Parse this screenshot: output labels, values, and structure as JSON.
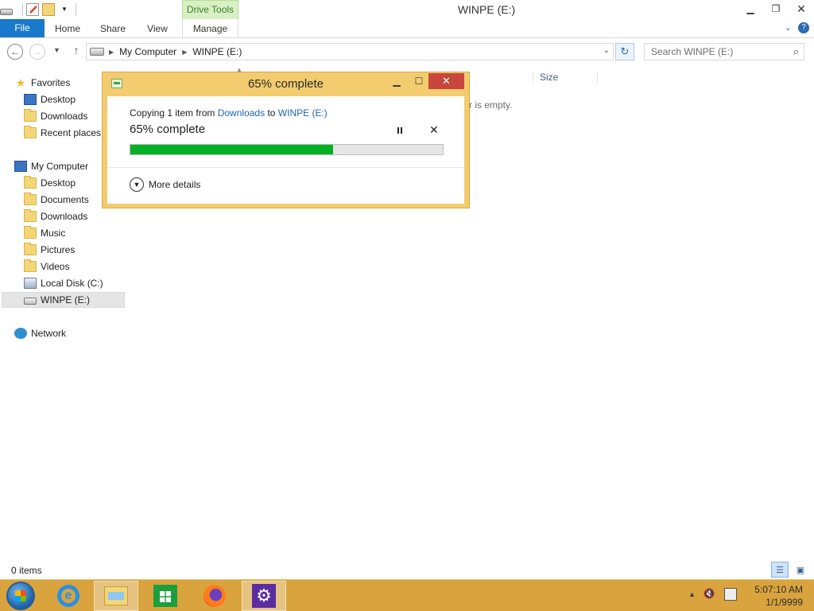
{
  "window": {
    "title": "WINPE (E:)",
    "contextual_tab": "Drive Tools"
  },
  "ribbon": {
    "tabs": [
      "File",
      "Home",
      "Share",
      "View",
      "Manage"
    ]
  },
  "address": {
    "crumbs": [
      "My Computer",
      "WINPE (E:)"
    ],
    "search_placeholder": "Search WINPE (E:)"
  },
  "navigation": {
    "favorites_label": "Favorites",
    "favorites": [
      "Desktop",
      "Downloads",
      "Recent places"
    ],
    "computer_label": "My Computer",
    "computer_items": [
      "Desktop",
      "Documents",
      "Downloads",
      "Music",
      "Pictures",
      "Videos",
      "Local Disk (C:)",
      "WINPE (E:)"
    ],
    "network_label": "Network"
  },
  "content": {
    "column_size": "Size",
    "empty_text": "r is empty."
  },
  "status": {
    "items": "0 items"
  },
  "dialog": {
    "title": "65% complete",
    "copy_prefix": "Copying 1 item from",
    "source": "Downloads",
    "to_word": "to",
    "destination": "WINPE (E:)",
    "percent_text": "65% complete",
    "progress_fraction": 0.65,
    "more_details": "More details"
  },
  "clock": {
    "time": "5:07:10 AM",
    "date": "1/1/9999"
  },
  "colors": {
    "progress_green": "#06b025",
    "dialog_frame": "#f3cc6f",
    "taskbar": "#d9a43e",
    "file_tab": "#1979ca",
    "close_red": "#c9463d"
  },
  "icons": {
    "taskbar": [
      "start-orb-icon",
      "internet-explorer-icon",
      "file-explorer-icon",
      "store-icon",
      "firefox-icon",
      "settings-icon"
    ]
  }
}
